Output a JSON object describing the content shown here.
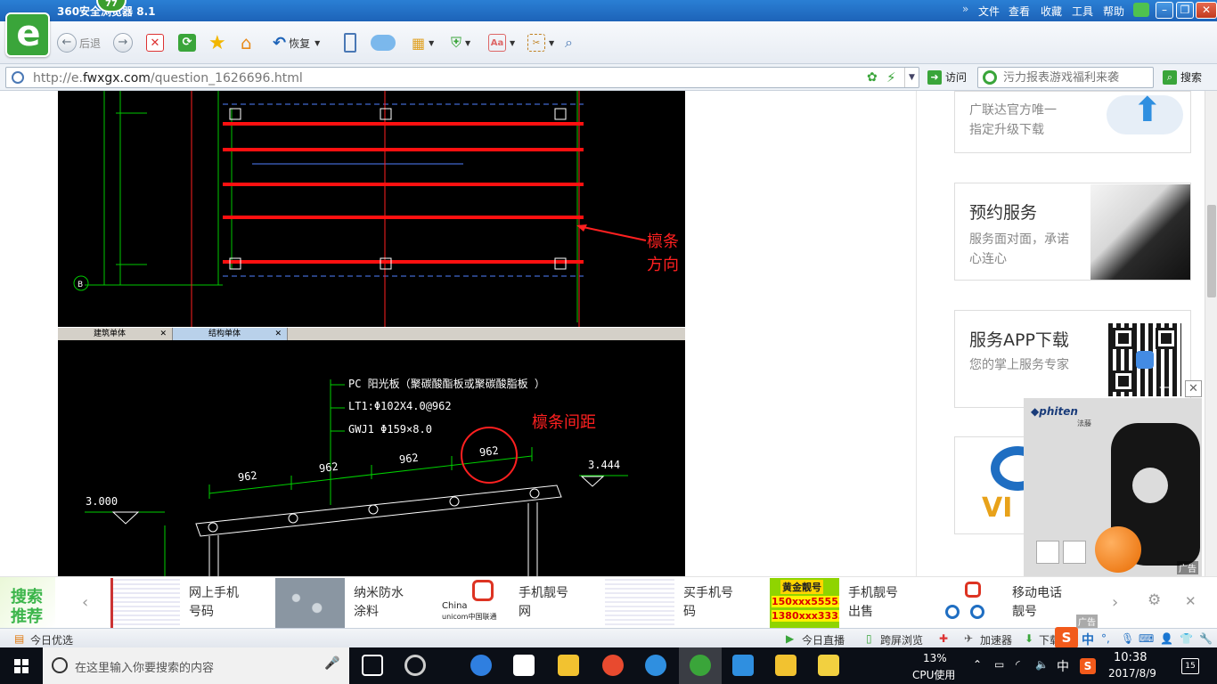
{
  "browser": {
    "title": "360安全浏览器 8.1",
    "badge": "77",
    "menu": [
      "文件",
      "查看",
      "收藏",
      "工具",
      "帮助"
    ],
    "window_controls": [
      "minimize",
      "restore",
      "close"
    ]
  },
  "toolbar": {
    "back_label": "后退",
    "restore_label": "恢复"
  },
  "address": {
    "url_prefix": "http://e.",
    "url_domain": "fwxgx.com",
    "url_path": "/question_1626696.html",
    "go_label": "访问",
    "search_placeholder": "污力报表游戏福利来袭",
    "search_label": "搜索"
  },
  "cad_top": {
    "annotation": "檩条方向",
    "tabs": [
      "建筑单体",
      "结构单体"
    ]
  },
  "cad_bottom": {
    "labels": [
      "PC 阳光板（聚碳酸酯板或聚碳酸脂板     ）",
      "LT1:Φ102X4.0@962",
      "GWJ1 Φ159×8.0"
    ],
    "annotation": "檩条间距",
    "spacings": [
      "962",
      "962",
      "962",
      "962"
    ],
    "elev_left": "3.000",
    "elev_right": "3.444"
  },
  "sidebar": {
    "card1": {
      "line1": "广联达官方唯一",
      "line2": "指定升级下载"
    },
    "card2": {
      "title": "预约服务",
      "desc": "服务面对面，承诺心连心"
    },
    "card3": {
      "title": "服务APP下载",
      "desc": "您的掌上服务专家"
    },
    "card4": {
      "text": "VI"
    }
  },
  "float_ad": {
    "brand": "phiten",
    "brand_cn": "法藤",
    "tag": "广告"
  },
  "recommend": {
    "label_line1": "搜索",
    "label_line2": "推荐",
    "items": [
      {
        "line1": "网上手机",
        "line2": "号码"
      },
      {
        "line1": "纳米防水",
        "line2": "涂料"
      },
      {
        "line1": "手机靓号",
        "line2": "网"
      },
      {
        "line1": "买手机号",
        "line2": "码"
      },
      {
        "line1": "手机靓号",
        "line2": "出售"
      },
      {
        "line1": "移动电话",
        "line2": "靓号"
      }
    ],
    "thumb3_text1": "China",
    "thumb3_text2": "unicom中国联通",
    "thumb5_title": "黄金靓号",
    "thumb5_line1": "150xxx55555",
    "thumb5_line2": "1380xxx3333",
    "ad_tag": "广告"
  },
  "statusbar": {
    "left": "今日优选",
    "live": "今日直播",
    "screen": "跨屏浏览",
    "accel": "加速器",
    "download": "下载",
    "ime": "中"
  },
  "taskbar": {
    "search_placeholder": "在这里输入你要搜索的内容",
    "cpu_pct": "13%",
    "cpu_label": "CPU使用",
    "ime": "中",
    "time": "10:38",
    "date": "2017/8/9",
    "notif": "15"
  },
  "colors": {
    "accent_green": "#3aa53a",
    "title_blue": "#1d63b8",
    "cad_green": "#00d000",
    "cad_red": "#ff2020"
  }
}
